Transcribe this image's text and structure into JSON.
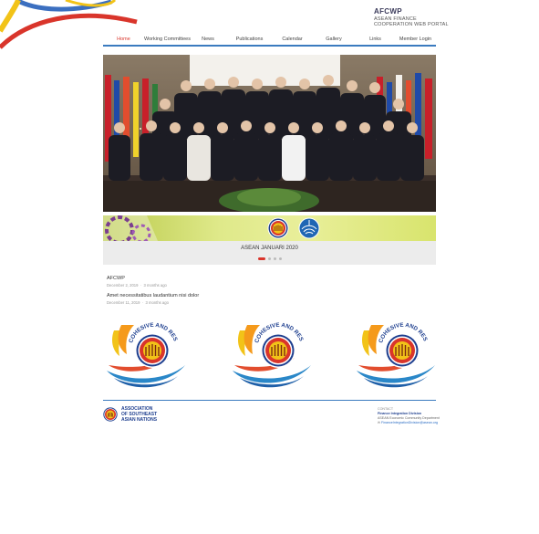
{
  "brand": {
    "name": "AFCWP",
    "tagline_1": "ASEAN FINANCE",
    "tagline_2": "COOPERATION WEB PORTAL"
  },
  "nav": {
    "items": [
      {
        "label": "Home",
        "active": true
      },
      {
        "label": "Working Committees",
        "active": false
      },
      {
        "label": "News",
        "active": false
      },
      {
        "label": "Publications",
        "active": false
      },
      {
        "label": "Calendar",
        "active": false
      },
      {
        "label": "Gallery",
        "active": false
      },
      {
        "label": "Links",
        "active": false
      },
      {
        "label": "Member Login",
        "active": false
      }
    ]
  },
  "slider": {
    "caption": "ASEAN JANUARI 2020",
    "slide_count": 4,
    "active_index": 0
  },
  "posts": [
    {
      "title": "AFCWP",
      "date": "December 2, 2019",
      "ago": "3 months ago"
    },
    {
      "title": "Amet necessitatibus laudantium nisi dolor",
      "date": "December 11, 2019",
      "ago": "3 months ago"
    }
  ],
  "emblem": {
    "text": "COHESIVE AND RESPONSIVE",
    "count": 3
  },
  "footer": {
    "org_line_1": "ASSOCIATION",
    "org_line_2": "OF SOUTHEAST",
    "org_line_3": "ASIAN NATIONS",
    "contact_heading": "CONTACT",
    "contact_division": "Finance Integration Division",
    "contact_department": "ASEAN Economic Community Department",
    "contact_email": "FinanceIntegrationDivision@asean.org"
  },
  "colors": {
    "accent_red": "#d9352b",
    "accent_blue": "#3b7bbf",
    "asean_blue": "#1e3f8f",
    "banner_green": "#d8e46d"
  }
}
